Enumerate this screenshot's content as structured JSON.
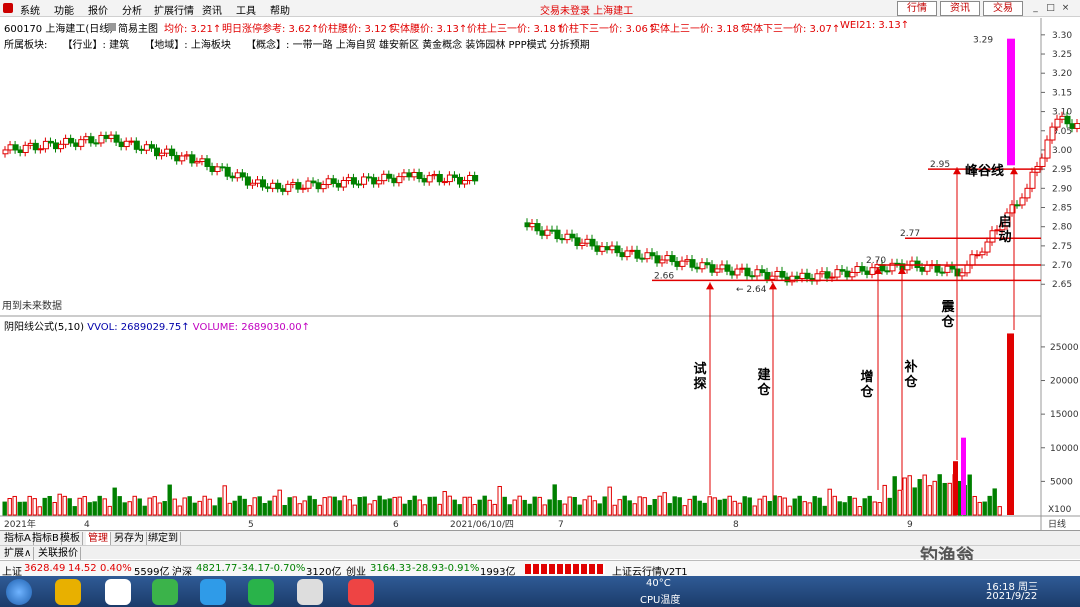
{
  "menubar": {
    "items": [
      "系统",
      "功能",
      "报价",
      "分析",
      "扩展行情",
      "资讯",
      "工具",
      "帮助"
    ],
    "center_title": "交易未登录 上海建工",
    "buttons": [
      "行情",
      "资讯",
      "交易"
    ]
  },
  "infoline": {
    "code_name": "600170 上海建工(日线)",
    "template": "简易主图",
    "fields": [
      "均价: 3.21↑",
      "明日涨停参考: 3.62↑",
      "价柱腰价: 3.12↑",
      "实体腰价: 3.13↑",
      "价柱上三一价: 3.18↑",
      "价柱下三一价: 3.06↑",
      "实体上三一价: 3.18↑",
      "实体下三一价: 3.07↑",
      "WEI21: 3.13↑"
    ]
  },
  "sector": {
    "label": "所属板块:",
    "industry": "【行业】: 建筑",
    "region": "【地域】: 上海板块",
    "concept": "【概念】: 一带一路 上海自贸 雄安新区 黄金概念 装饰园林 PPP模式 分拆预期"
  },
  "future_note": "用到未来数据",
  "volume_title": {
    "name": "阴阳线公式(5,10)",
    "vol": "VVOL: 2689029.75↑",
    "volume": "VOLUME: 2689030.00↑"
  },
  "price_axis": [
    "3.30",
    "3.25",
    "3.20",
    "3.15",
    "3.10",
    "3.05",
    "3.00",
    "2.95",
    "2.90",
    "2.85",
    "2.80",
    "2.75",
    "2.70",
    "2.65"
  ],
  "volume_axis": [
    "25000",
    "20000",
    "15000",
    "10000",
    "5000"
  ],
  "volume_unit": "X100",
  "period": "日线",
  "date_axis": [
    "2021年",
    "4",
    "5",
    "6",
    "2021/06/10/四",
    "7",
    "8",
    "9"
  ],
  "annotations": {
    "high": "3.29",
    "low": "2.64",
    "p266": "2.66",
    "p270": "2.70",
    "p277": "2.77",
    "p295": "2.95",
    "peak_line": "峰谷线",
    "start": "启动",
    "probe": "试探",
    "build": "建仓",
    "add": "增仓",
    "supplement": "补仓",
    "shake": "震仓",
    "start_chart": "启动"
  },
  "bottom_tabs": [
    "2021年",
    "指标A",
    "指标B",
    "模板",
    "管理",
    "另存为",
    "绑定到"
  ],
  "sub_tabs": [
    "扩展∧",
    "关联报价"
  ],
  "indexbar": {
    "sh": "上证",
    "sh_val": "3628.49",
    "sh_chg": "14.52",
    "sh_pct": "0.40%",
    "sh_amt": "5599亿",
    "hs": "沪深",
    "hs_val": "4821.77",
    "hs_chg": "-34.17",
    "hs_pct": "-0.70%",
    "hs_amt": "3120亿",
    "cy": "创业",
    "cy_val": "3164.33",
    "cy_chg": "-28.93",
    "cy_pct": "-0.91%",
    "cy_amt": "1993亿",
    "cloud": "上证云行情V2T1"
  },
  "taskbar": {
    "temp": "40°C",
    "cpu": "CPU温度",
    "time": "16:18 周三",
    "date": "2021/9/22"
  },
  "watermark": "钓渔翁",
  "chart_data": {
    "type": "candlestick",
    "title": "600170 上海建工(日线)",
    "ylim": [
      2.62,
      3.32
    ],
    "high": 3.29,
    "low": 2.64,
    "resistance": [
      2.95,
      2.77,
      2.7,
      2.66
    ]
  },
  "colors": {
    "up": "#e00000",
    "down": "#008000",
    "accent": "#ff00ff"
  }
}
